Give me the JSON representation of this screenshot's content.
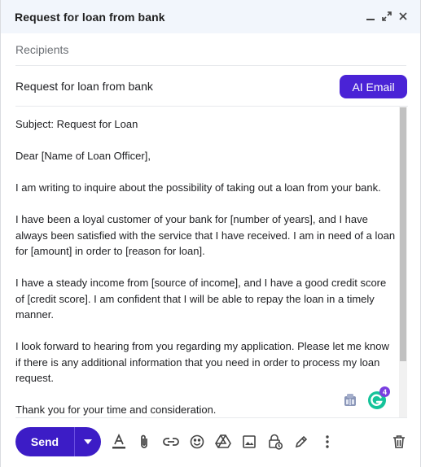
{
  "window": {
    "title": "Request for loan from bank"
  },
  "recipients": {
    "placeholder": "Recipients"
  },
  "subject": {
    "value": "Request for loan from bank"
  },
  "ai_button": {
    "label": "AI Email"
  },
  "body": {
    "paragraphs": [
      "Subject: Request for Loan",
      "Dear [Name of Loan Officer],",
      "I am writing to inquire about the possibility of taking out a loan from your bank.",
      "I have been a loyal customer of your bank for [number of years], and I have always been satisfied with the service that I have received. I am in need of a loan for [amount] in order to [reason for loan].",
      "I have a steady income from [source of income], and I have a good credit score of [credit score]. I am confident that I will be able to repay the loan in a timely manner.",
      "I look forward to hearing from you regarding my application. Please let me know if there is any additional information that you need in order to process my loan request.",
      "Thank you for your time and consideration."
    ]
  },
  "grammarly": {
    "badge_count": "4"
  },
  "send": {
    "label": "Send"
  },
  "colors": {
    "accent": "#3c1cc6",
    "ai_button": "#4a23d6",
    "titlebar": "#f2f6fc",
    "grammarly": "#15c39a"
  },
  "icons": {
    "minimize": "minimize-icon",
    "expand": "expand-icon",
    "close": "close-icon",
    "formatting": "text-format-icon",
    "attach": "paperclip-icon",
    "link": "link-icon",
    "emoji": "emoji-icon",
    "drive": "drive-icon",
    "photo": "image-icon",
    "confidential": "lock-clock-icon",
    "signature": "pen-icon",
    "more": "more-vert-icon",
    "discard": "trash-icon"
  }
}
